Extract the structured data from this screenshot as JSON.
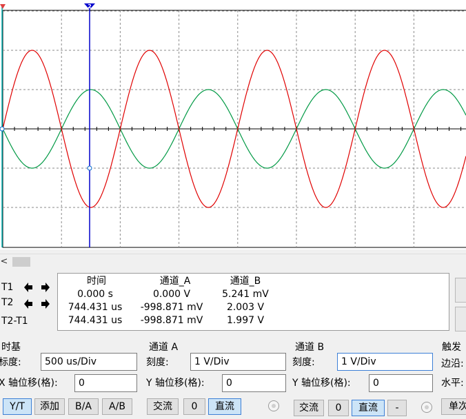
{
  "colors": {
    "channel_a": "#e00000",
    "channel_b": "#009944",
    "cursor_1": "#00b0b0",
    "cursor_2": "#0000cc",
    "grid": "#8a8a8a"
  },
  "oscilloscope": {
    "cursor_1_marker": "",
    "cursor_2_marker": "2"
  },
  "scrollbar": {
    "left_arrow": "<"
  },
  "readout": {
    "cursor_labels": [
      "T1",
      "T2",
      "T2-T1"
    ],
    "headers": [
      "时间",
      "通道_A",
      "通道_B"
    ],
    "rows": [
      [
        "0.000 s",
        "0.000 V",
        "5.241 mV"
      ],
      [
        "744.431 us",
        "-998.871 mV",
        "2.003 V"
      ],
      [
        "744.431 us",
        "-998.871 mV",
        "1.997 V"
      ]
    ]
  },
  "timebase": {
    "title": "时基",
    "scale_label": "标度:",
    "scale_value": "500 us/Div",
    "xpos_label": "X 轴位移(格):",
    "xpos_value": "0",
    "buttons": [
      "Y/T",
      "添加",
      "B/A",
      "A/B"
    ]
  },
  "channel_a": {
    "title": "通道 A",
    "scale_label": "刻度:",
    "scale_value": "1  V/Div",
    "ypos_label": "Y 轴位移(格):",
    "ypos_value": "0",
    "buttons": [
      "交流",
      "0",
      "直流"
    ]
  },
  "channel_b": {
    "title": "通道 B",
    "scale_label": "刻度:",
    "scale_value": "1  V/Div",
    "ypos_label": "Y 轴位移(格):",
    "ypos_value": "0",
    "buttons": [
      "交流",
      "0",
      "直流",
      "-"
    ]
  },
  "trigger": {
    "title": "触发",
    "edge_label": "边沿:",
    "level_label": "水平:",
    "single_button": "单次"
  }
}
